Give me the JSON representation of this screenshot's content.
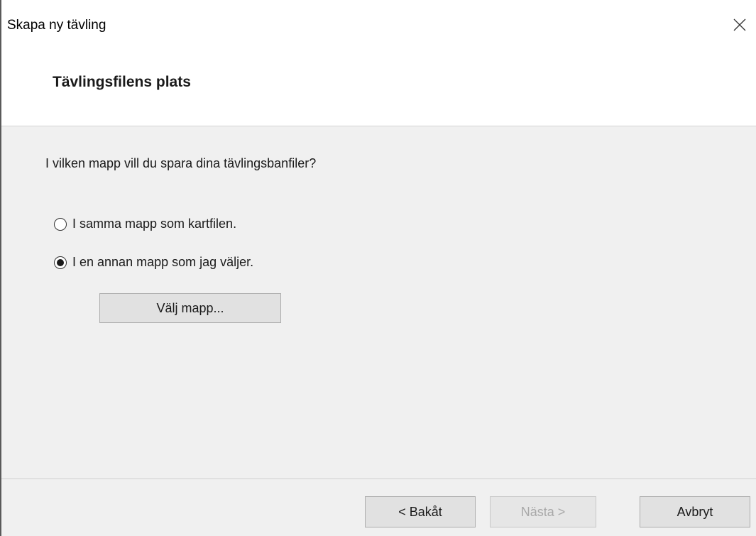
{
  "window": {
    "title": "Skapa ny tävling",
    "close_icon": "close-icon"
  },
  "header": {
    "title": "Tävlingsfilens plats"
  },
  "content": {
    "question": "I vilken mapp vill du spara dina tävlingsbanfiler?",
    "options": [
      {
        "label": "I samma mapp som kartfilen.",
        "selected": false
      },
      {
        "label": "I en annan mapp som jag väljer.",
        "selected": true
      }
    ],
    "choose_folder_label": "Välj mapp..."
  },
  "footer": {
    "back_label": "< Bakåt",
    "next_label": "Nästa >",
    "next_enabled": false,
    "cancel_label": "Avbryt"
  }
}
